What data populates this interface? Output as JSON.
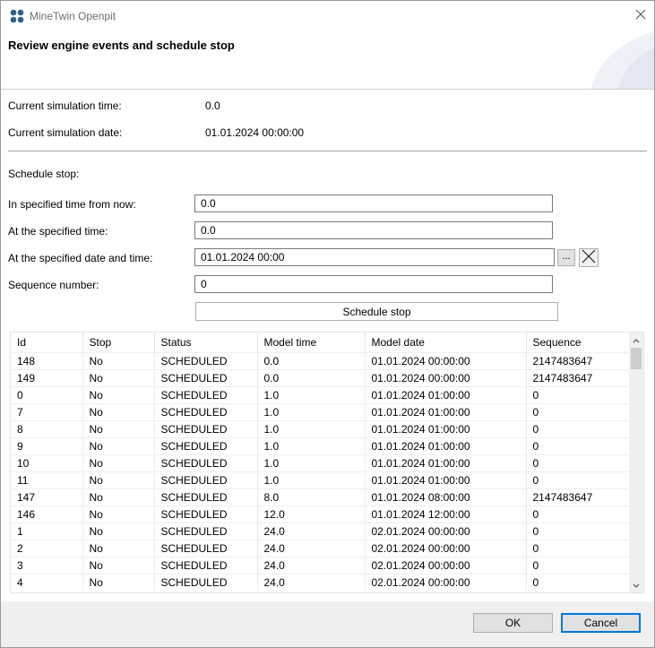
{
  "window": {
    "title": "MineTwin Openpit"
  },
  "header": {
    "title": "Review engine events and schedule stop"
  },
  "info": {
    "time_label": "Current simulation time:",
    "time_value": "0.0",
    "date_label": "Current simulation date:",
    "date_value": "01.01.2024 00:00:00"
  },
  "schedule": {
    "section_label": "Schedule stop:",
    "from_now_label": "In specified time from now:",
    "from_now_value": "0.0",
    "at_time_label": "At the specified time:",
    "at_time_value": "0.0",
    "at_date_label": "At the specified date and time:",
    "at_date_value": "01.01.2024 00:00",
    "picker_label": "...",
    "sequence_label": "Sequence number:",
    "sequence_value": "0",
    "button_label": "Schedule stop"
  },
  "table": {
    "columns": [
      "Id",
      "Stop",
      "Status",
      "Model time",
      "Model date",
      "Sequence"
    ],
    "rows": [
      [
        "148",
        "No",
        "SCHEDULED",
        "0.0",
        "01.01.2024 00:00:00",
        "2147483647"
      ],
      [
        "149",
        "No",
        "SCHEDULED",
        "0.0",
        "01.01.2024 00:00:00",
        "2147483647"
      ],
      [
        "0",
        "No",
        "SCHEDULED",
        "1.0",
        "01.01.2024 01:00:00",
        "0"
      ],
      [
        "7",
        "No",
        "SCHEDULED",
        "1.0",
        "01.01.2024 01:00:00",
        "0"
      ],
      [
        "8",
        "No",
        "SCHEDULED",
        "1.0",
        "01.01.2024 01:00:00",
        "0"
      ],
      [
        "9",
        "No",
        "SCHEDULED",
        "1.0",
        "01.01.2024 01:00:00",
        "0"
      ],
      [
        "10",
        "No",
        "SCHEDULED",
        "1.0",
        "01.01.2024 01:00:00",
        "0"
      ],
      [
        "11",
        "No",
        "SCHEDULED",
        "1.0",
        "01.01.2024 01:00:00",
        "0"
      ],
      [
        "147",
        "No",
        "SCHEDULED",
        "8.0",
        "01.01.2024 08:00:00",
        "2147483647"
      ],
      [
        "146",
        "No",
        "SCHEDULED",
        "12.0",
        "01.01.2024 12:00:00",
        "0"
      ],
      [
        "1",
        "No",
        "SCHEDULED",
        "24.0",
        "02.01.2024 00:00:00",
        "0"
      ],
      [
        "2",
        "No",
        "SCHEDULED",
        "24.0",
        "02.01.2024 00:00:00",
        "0"
      ],
      [
        "3",
        "No",
        "SCHEDULED",
        "24.0",
        "02.01.2024 00:00:00",
        "0"
      ],
      [
        "4",
        "No",
        "SCHEDULED",
        "24.0",
        "02.01.2024 00:00:00",
        "0"
      ]
    ]
  },
  "footer": {
    "ok_label": "OK",
    "cancel_label": "Cancel"
  },
  "colors": {
    "accent": "#0078d7",
    "footer_bg": "#f0f0f0",
    "app_icon": "#2f5f8a"
  },
  "icons": {
    "app": "app-logo-icon",
    "close": "close-icon",
    "clear": "clear-x-icon",
    "scroll_up": "chevron-up-icon",
    "scroll_down": "chevron-down-icon"
  }
}
